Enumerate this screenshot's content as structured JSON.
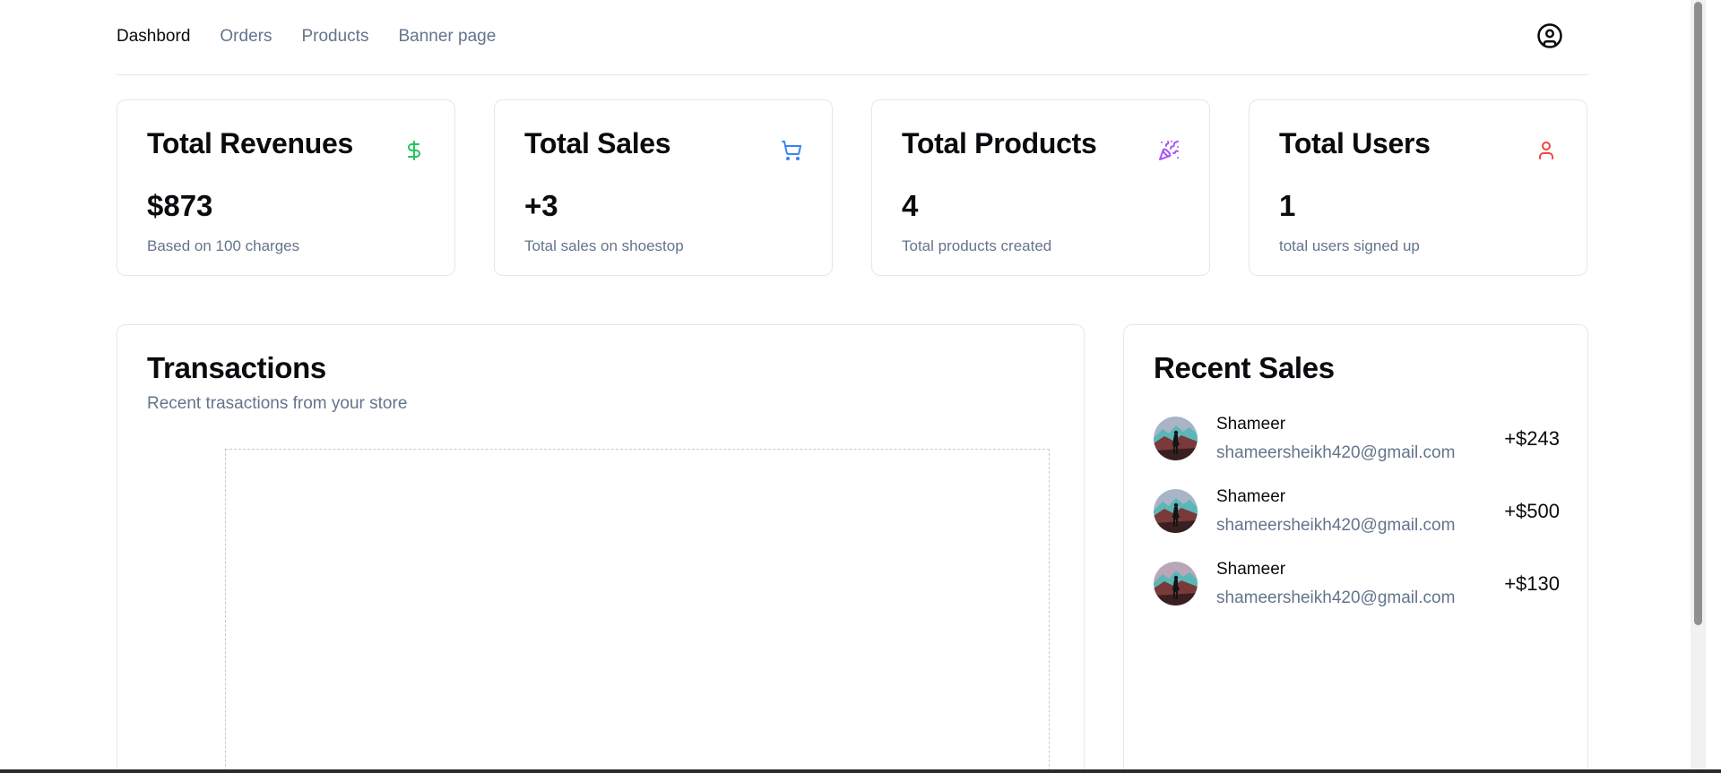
{
  "nav": {
    "links": [
      "Dashbord",
      "Orders",
      "Products",
      "Banner page"
    ],
    "active_index": 0,
    "user_icon": "user-circle-icon"
  },
  "stats": [
    {
      "title": "Total Revenues",
      "value": "$873",
      "desc": "Based on 100 charges",
      "icon": "dollar-sign-icon",
      "color": "#22c55e"
    },
    {
      "title": "Total Sales",
      "value": "+3",
      "desc": "Total sales on shoestop",
      "icon": "shopping-cart-icon",
      "color": "#3b82f6"
    },
    {
      "title": "Total Products",
      "value": "4",
      "desc": "Total products created",
      "icon": "party-popper-icon",
      "color": "#a855f7"
    },
    {
      "title": "Total Users",
      "value": "1",
      "desc": "total users signed up",
      "icon": "user-icon",
      "color": "#ef4444"
    }
  ],
  "transactions": {
    "title": "Transactions",
    "subtitle": "Recent trasactions from your store"
  },
  "recent_sales": {
    "title": "Recent Sales",
    "items": [
      {
        "name": "Shameer",
        "email": "shameersheikh420@gmail.com",
        "amount": "+$243"
      },
      {
        "name": "Shameer",
        "email": "shameersheikh420@gmail.com",
        "amount": "+$500"
      },
      {
        "name": "Shameer",
        "email": "shameersheikh420@gmail.com",
        "amount": "+$130"
      }
    ]
  },
  "colors": {
    "text": "#0a0a0f",
    "muted": "#64748b",
    "border": "#e5e7eb"
  }
}
